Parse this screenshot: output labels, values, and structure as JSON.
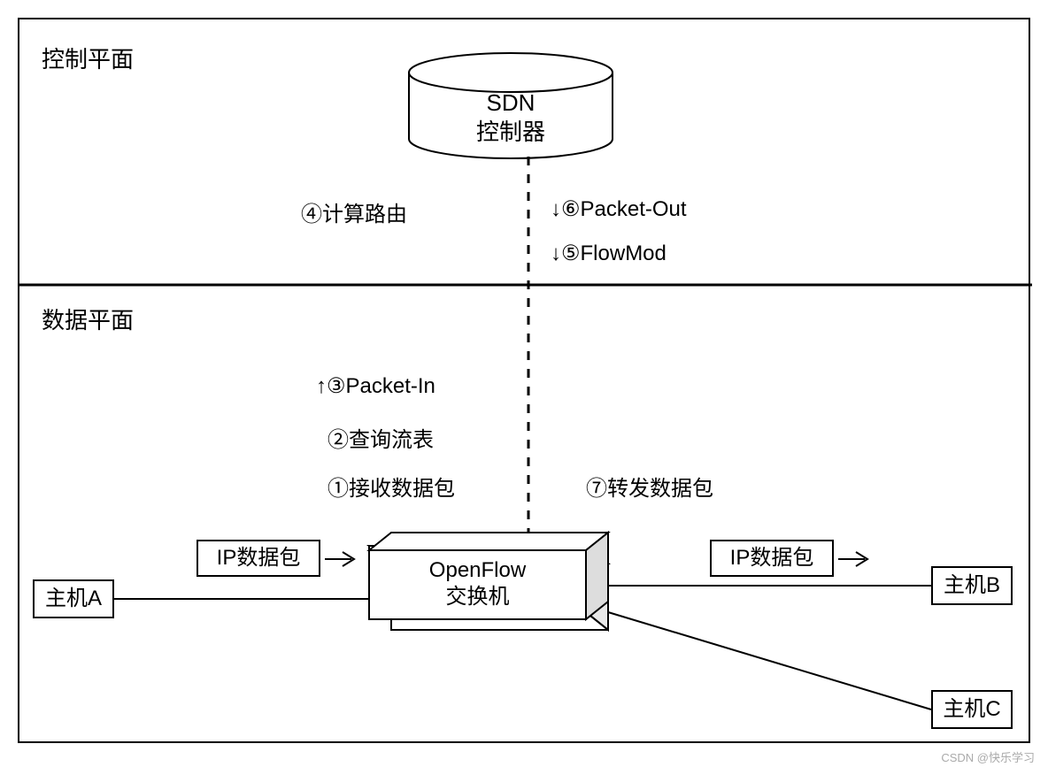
{
  "planes": {
    "control": "控制平面",
    "data": "数据平面"
  },
  "nodes": {
    "controller": {
      "line1": "SDN",
      "line2": "控制器"
    },
    "switch": {
      "line1": "OpenFlow",
      "line2": "交换机"
    },
    "hostA": "主机A",
    "hostB": "主机B",
    "hostC": "主机C",
    "ipPacketLeft": "IP数据包",
    "ipPacketRight": "IP数据包"
  },
  "steps": {
    "s1": "①接收数据包",
    "s2": "②查询流表",
    "s3": "↑③Packet-In",
    "s4": "④计算路由",
    "s5": "↓⑤FlowMod",
    "s6": "↓⑥Packet-Out",
    "s7": "⑦转发数据包"
  },
  "watermark": "CSDN @快乐学习"
}
